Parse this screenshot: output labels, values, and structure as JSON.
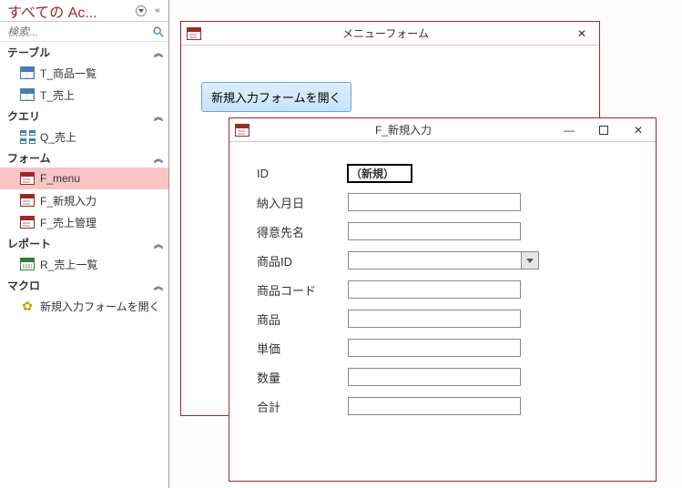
{
  "nav": {
    "title": "すべての Ac...",
    "search_placeholder": "検索...",
    "groups": {
      "tables": {
        "label": "テーブル",
        "items": [
          "T_商品一覧",
          "T_売上"
        ]
      },
      "queries": {
        "label": "クエリ",
        "items": [
          "Q_売上"
        ]
      },
      "forms": {
        "label": "フォーム",
        "items": [
          "F_menu",
          "F_新規入力",
          "F_売上管理"
        ]
      },
      "reports": {
        "label": "レポート",
        "items": [
          "R_売上一覧"
        ]
      },
      "macros": {
        "label": "マクロ",
        "items": [
          "新規入力フォームを開く"
        ]
      }
    }
  },
  "menu_form": {
    "title": "メニューフォーム",
    "open_button": "新規入力フォームを開く"
  },
  "entry_form": {
    "title": "F_新規入力",
    "id_label": "ID",
    "id_value": "（新規）",
    "fields": {
      "delivery_date": "納入月日",
      "customer": "得意先名",
      "product_id": "商品ID",
      "product_code": "商品コード",
      "product": "商品",
      "unit_price": "単価",
      "quantity": "数量",
      "total": "合計"
    }
  }
}
